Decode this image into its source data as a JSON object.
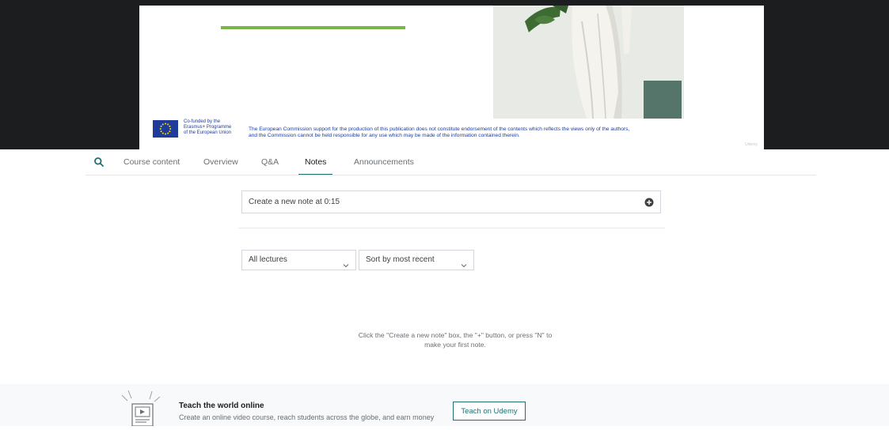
{
  "slide": {
    "eu_line1": "Co-funded by the",
    "eu_line2": "Erasmus+ Programme",
    "eu_line3": "of the European Union",
    "disclaimer_line1": "The European Commission support for the production of this publication does not constitute endorsement of the contents which reflects the views only of the authors,",
    "disclaimer_line2": "and the Commission cannot be held responsible for any use which may be made of the information contained therein.",
    "watermark": "Udemy"
  },
  "tabs": [
    {
      "label": "Course content"
    },
    {
      "label": "Overview"
    },
    {
      "label": "Q&A"
    },
    {
      "label": "Notes",
      "active": true
    },
    {
      "label": "Announcements"
    }
  ],
  "notes": {
    "create_placeholder": "Create a new note at 0:15",
    "lecture_filter": "All lectures",
    "sort": "Sort by most recent",
    "empty_line1": "Click the \"Create a new note\" box, the \"+\" button, or press \"N\" to",
    "empty_line2": "make your first note."
  },
  "teach": {
    "title": "Teach the world online",
    "subtitle": "Create an online video course, reach students across the globe, and earn money",
    "button": "Teach on Udemy"
  },
  "colors": {
    "accent": "#1c7073",
    "slide_green": "#7ab648",
    "eu_blue": "#1f3c99",
    "video_bg": "#1c1d1f"
  }
}
